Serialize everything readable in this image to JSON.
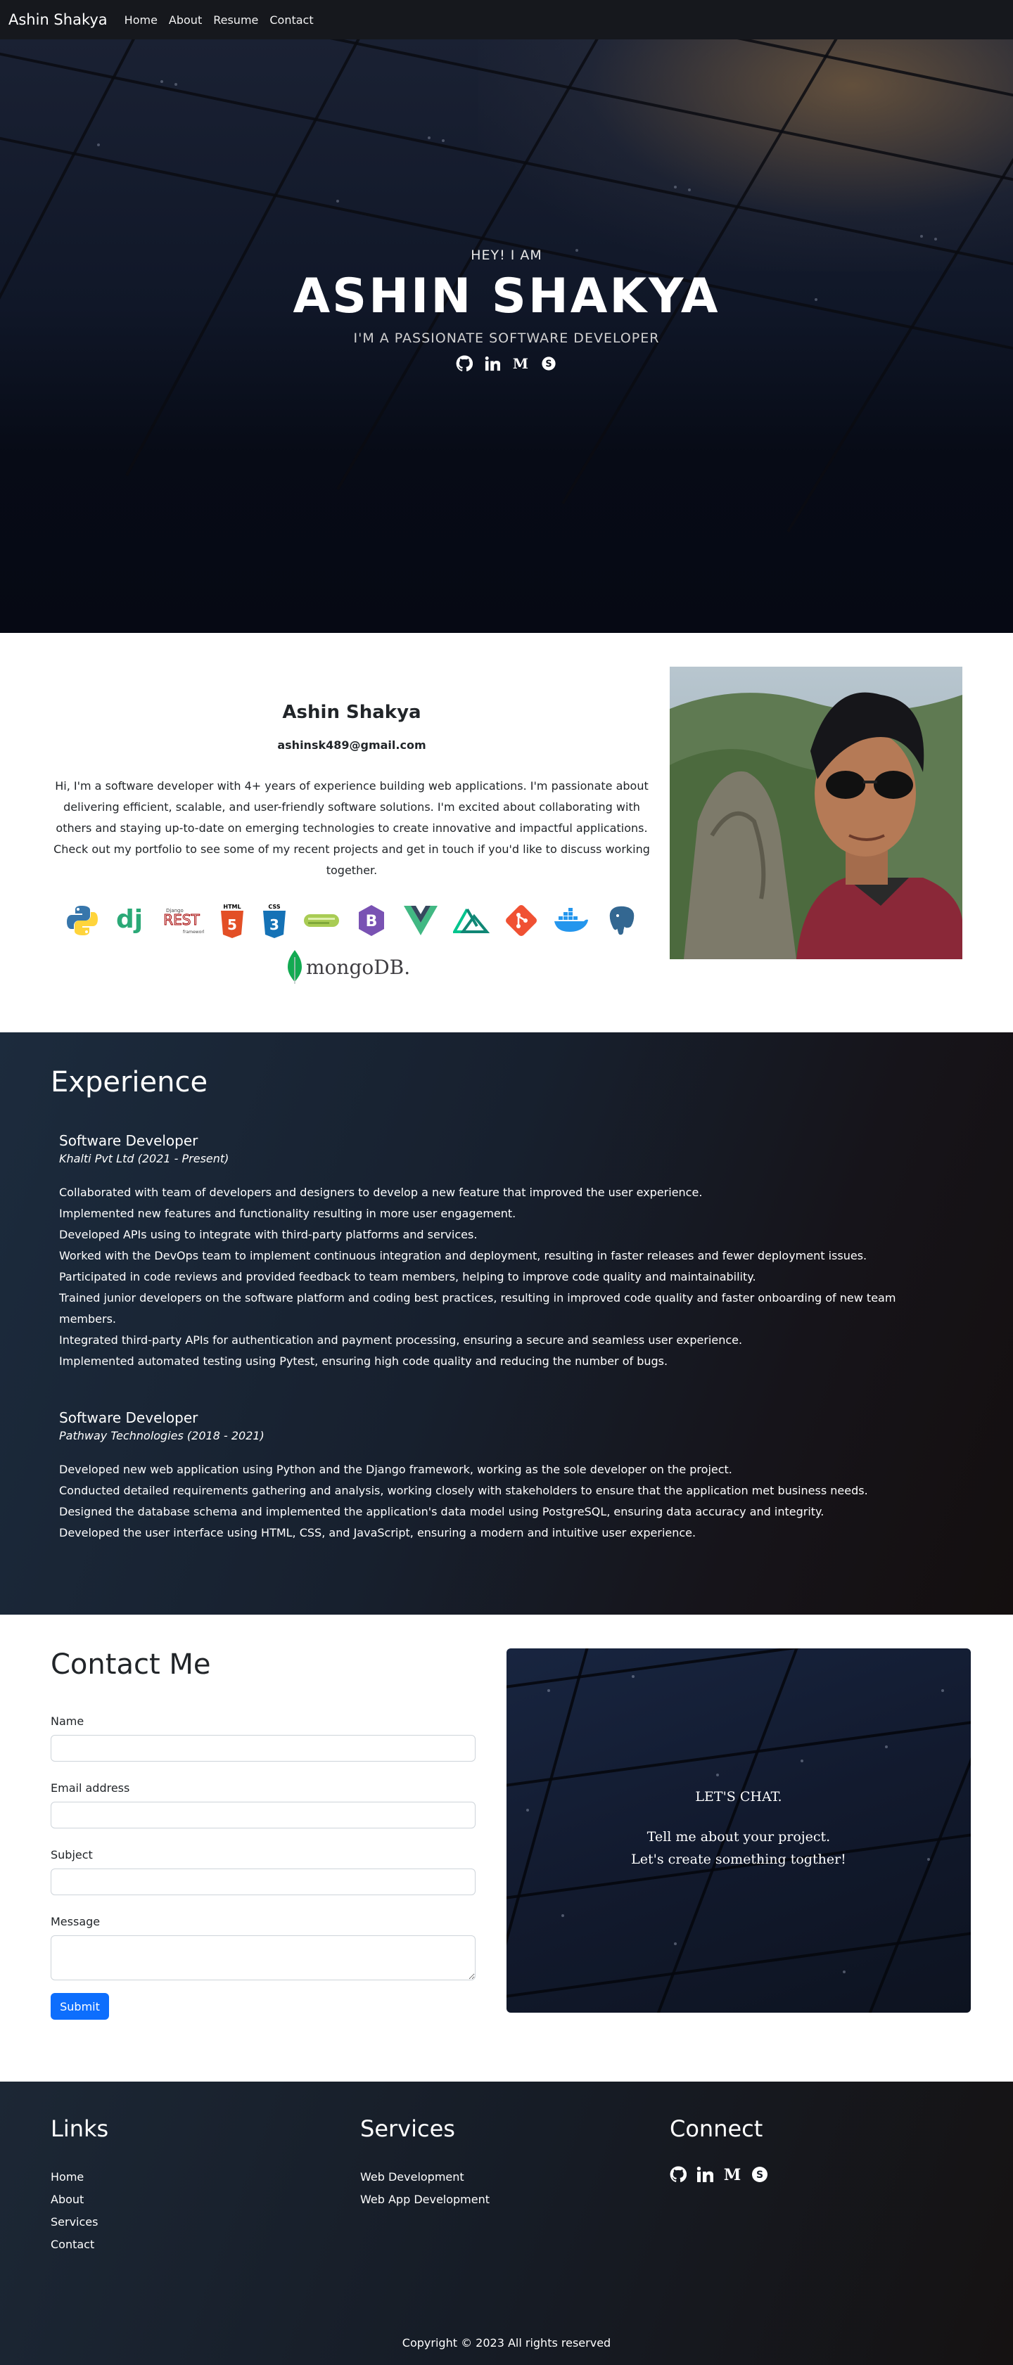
{
  "nav": {
    "brand": "Ashin Shakya",
    "links": [
      "Home",
      "About",
      "Resume",
      "Contact"
    ]
  },
  "hero": {
    "greeting": "HEY! I AM",
    "name": "ASHIN SHAKYA",
    "tagline": "I'M A PASSIONATE SOFTWARE DEVELOPER",
    "social_icons": [
      "github-icon",
      "linkedin-icon",
      "medium-icon",
      "skype-icon"
    ]
  },
  "about": {
    "name": "Ashin Shakya",
    "email": "ashinsk489@gmail.com",
    "bio": "Hi, I'm a software developer with 4+ years of experience building web applications. I'm passionate about delivering efficient, scalable, and user-friendly software solutions. I'm excited about collaborating with others and staying up-to-date on emerging technologies to create innovative and impactful applications. Check out my portfolio to see some of my recent projects and get in touch if you'd like to discuss working together.",
    "tech_icons": [
      "python-icon",
      "django-icon",
      "django-rest-framework-icon",
      "html5-icon",
      "css3-icon",
      "celery-icon",
      "bootstrap-icon",
      "vue-icon",
      "nuxt-icon",
      "git-icon",
      "docker-icon",
      "postgresql-icon",
      "mongodb-icon"
    ],
    "tech_labels": {
      "django": "dj",
      "drf_top": "Django",
      "drf": "REST",
      "drf_bottom": "framework",
      "html": "HTML",
      "css": "CSS",
      "mongodb": "mongoDB."
    }
  },
  "experience": {
    "heading": "Experience",
    "jobs": [
      {
        "title": "Software Developer",
        "company": "Khalti Pvt Ltd (2021 - Present)",
        "items": [
          "Collaborated with team of developers and designers to develop a new feature that improved the user experience.",
          "Implemented new features and functionality resulting in more user engagement.",
          "Developed APIs using to integrate with third-party platforms and services.",
          "Worked with the DevOps team to implement continuous integration and deployment, resulting in faster releases and fewer deployment issues.",
          "Participated in code reviews and provided feedback to team members, helping to improve code quality and maintainability.",
          "Trained junior developers on the software platform and coding best practices, resulting in improved code quality and faster onboarding of new team members.",
          "Integrated third-party APIs for authentication and payment processing, ensuring a secure and seamless user experience.",
          "Implemented automated testing using Pytest, ensuring high code quality and reducing the number of bugs."
        ]
      },
      {
        "title": "Software Developer",
        "company": "Pathway Technologies (2018 - 2021)",
        "items": [
          "Developed new web application using Python and the Django framework, working as the sole developer on the project.",
          "Conducted detailed requirements gathering and analysis, working closely with stakeholders to ensure that the application met business needs.",
          "Designed the database schema and implemented the application's data model using PostgreSQL, ensuring data accuracy and integrity.",
          "Developed the user interface using HTML, CSS, and JavaScript, ensuring a modern and intuitive user experience."
        ]
      }
    ]
  },
  "contact": {
    "heading": "Contact Me",
    "fields": {
      "name": "Name",
      "email": "Email address",
      "subject": "Subject",
      "message": "Message"
    },
    "submit": "Submit",
    "chat_heading": "LET'S CHAT.",
    "chat_line1": "Tell me about your project.",
    "chat_line2": "Let's create something togther!"
  },
  "footer": {
    "links_heading": "Links",
    "links": [
      "Home",
      "About",
      "Services",
      "Contact"
    ],
    "services_heading": "Services",
    "services": [
      "Web Development",
      "Web App Development"
    ],
    "connect_heading": "Connect",
    "copyright": "Copyright © 2023 All rights reserved"
  },
  "colors": {
    "accent": "#0d6efd",
    "nav_bg": "#16181d"
  }
}
